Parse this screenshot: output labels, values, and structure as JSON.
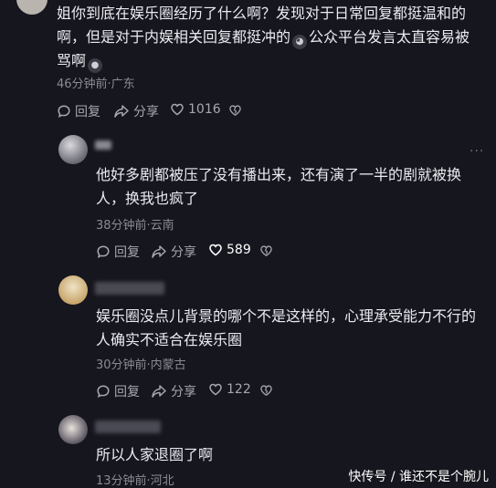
{
  "c1": {
    "text_a": "姐你到底在娱乐圈经历了什么啊？发现对于日常回复都挺温和的啊，但是对于内娱相关回复都挺冲的",
    "text_b": "公众平台发言太直容易被骂啊",
    "meta": "46分钟前·广东",
    "reply": "回复",
    "share": "分享",
    "likes": "1016"
  },
  "r1": {
    "text": "他好多剧都被压了没有播出来，还有演了一半的剧就被换人，换我也疯了",
    "meta": "38分钟前·云南",
    "reply": "回复",
    "share": "分享",
    "likes": "589"
  },
  "r2": {
    "text": "娱乐圈没点儿背景的哪个不是这样的，心理承受能力不行的人确实不适合在娱乐圈",
    "meta": "30分钟前·内蒙古",
    "reply": "回复",
    "share": "分享",
    "likes": "122"
  },
  "r3": {
    "text": "所以人家退圈了啊",
    "meta": "13分钟前·河北"
  },
  "watermark": "快传号 / 谁还不是个腕儿",
  "more_glyph": "···",
  "colors": {
    "bg": "#16161e",
    "text": "#ebebf0",
    "meta": "#8b8b95",
    "liked": "#ffffff"
  }
}
